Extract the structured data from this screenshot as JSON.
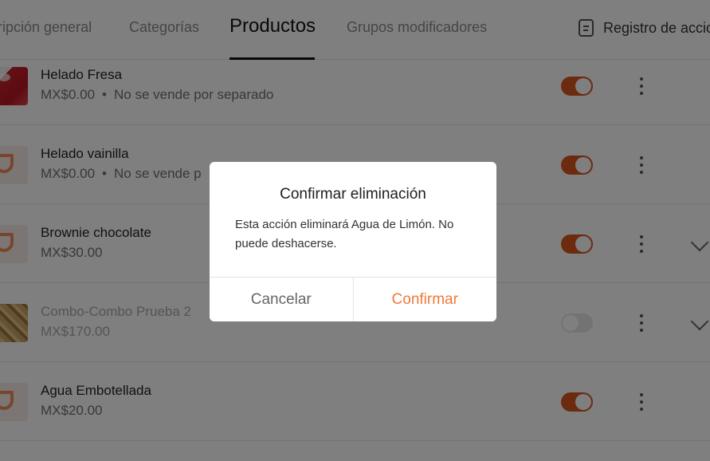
{
  "tabs": [
    {
      "label": "tripción general"
    },
    {
      "label": "Categorías"
    },
    {
      "label": "Productos"
    },
    {
      "label": "Grupos modificadores"
    },
    {
      "label": "Registro de accio"
    }
  ],
  "products": [
    {
      "name": "Helado Fresa",
      "price": "MX$0.00",
      "note": "No se vende por separado",
      "separator": "•",
      "enabled": true
    },
    {
      "name": "Helado vainilla",
      "price": "MX$0.00",
      "note": "No se vende p",
      "separator": "•",
      "enabled": true
    },
    {
      "name": "Brownie chocolate",
      "price": "MX$30.00",
      "enabled": true
    },
    {
      "name": "Combo-Combo Prueba 2",
      "price": "MX$170.00",
      "enabled": false
    },
    {
      "name": "Agua Embotellada",
      "price": "MX$20.00",
      "enabled": true
    }
  ],
  "modal": {
    "title": "Confirmar eliminación",
    "body": "Esta acción eliminará Agua de Limón. No puede deshacerse.",
    "cancel_label": "Cancelar",
    "confirm_label": "Confirmar"
  },
  "colors": {
    "accent": "#f07a3a",
    "toggle_on": "#d9541e",
    "toggle_off": "#e7e7e7"
  }
}
